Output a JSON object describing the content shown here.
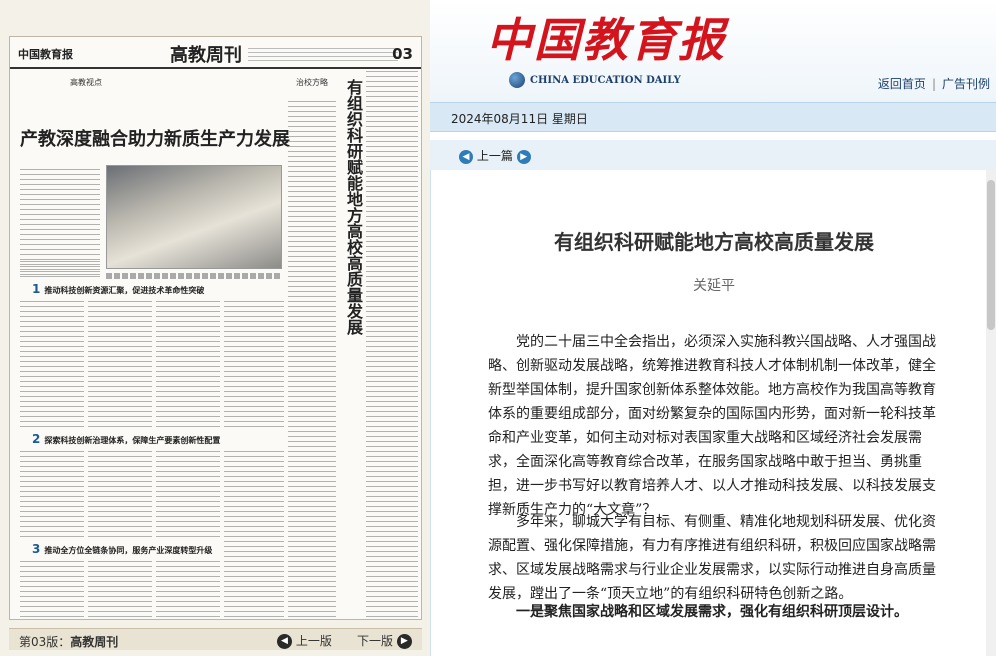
{
  "left_page": {
    "paper_logo": "中国教育报",
    "edition_title": "高教周刊",
    "page_number": "03",
    "column_heads": [
      "高教视点",
      "治校方略"
    ],
    "banner_headline": "产教深度融合助力新质生产力发展",
    "vertical_headline": "有组织科研赋能地方高校高质量发展",
    "sections": [
      {
        "num": "1",
        "text": "推动科技创新资源汇聚，促进技术革命性突破"
      },
      {
        "num": "2",
        "text": "探索科技创新治理体系，保障生产要素创新性配置"
      },
      {
        "num": "3",
        "text": "推动全方位全链条协同，服务产业深度转型升级"
      }
    ]
  },
  "nav": {
    "page_label": "第03版：",
    "page_name": "高教周刊",
    "prev_label": "上一版",
    "next_label": "下一版"
  },
  "header": {
    "brand_cn": "中国教育报",
    "brand_en": "CHINA EDUCATION DAILY",
    "links": [
      "返回首页",
      "广告刊例"
    ]
  },
  "date_line": "2024年08月11日  星期日",
  "prev_article_label": "上一篇",
  "article": {
    "title": "有组织科研赋能地方高校高质量发展",
    "author": "关延平",
    "paragraphs": [
      "党的二十届三中全会指出，必须深入实施科教兴国战略、人才强国战略、创新驱动发展战略，统筹推进教育科技人才体制机制一体改革，健全新型举国体制，提升国家创新体系整体效能。地方高校作为我国高等教育体系的重要组成部分，面对纷繁复杂的国际国内形势，面对新一轮科技革命和产业变革，如何主动对标对表国家重大战略和区域经济社会发展需求，全面深化高等教育综合改革，在服务国家战略中敢于担当、勇挑重担，进一步书写好以教育培养人才、以人才推动科技发展、以科技发展支撑新质生产力的“大文章”？",
      "多年来，聊城大学有目标、有侧重、精准化地规划科研发展、优化资源配置、强化保障措施，有力有序推进有组织科研，积极回应国家战略需求、区域发展战略需求与行业企业发展需求，以实际行动推进自身高质量发展，蹚出了一条“顶天立地”的有组织科研特色创新之路。",
      "一是聚焦国家战略和区域发展需求，强化有组织科研顶层设计。"
    ]
  }
}
